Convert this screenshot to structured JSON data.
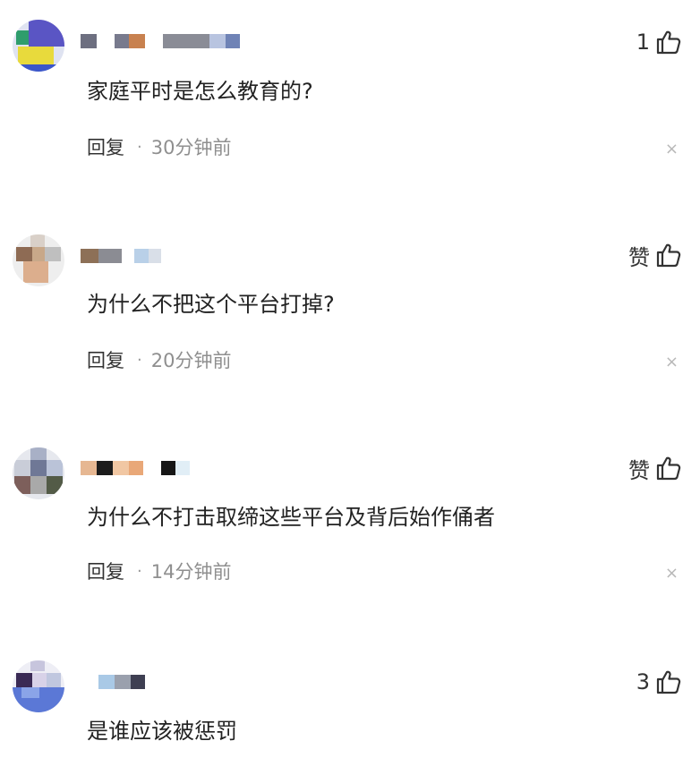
{
  "comments": [
    {
      "text": "家庭平时是怎么教育的?",
      "like_label": "1",
      "reply_label": "回复",
      "separator": "·",
      "time": "30分钟前",
      "close_glyph": "×"
    },
    {
      "text": "为什么不把这个平台打掉?",
      "like_label": "赞",
      "reply_label": "回复",
      "separator": "·",
      "time": "20分钟前",
      "close_glyph": "×"
    },
    {
      "text": "为什么不打击取缔这些平台及背后始作俑者",
      "like_label": "赞",
      "reply_label": "回复",
      "separator": "·",
      "time": "14分钟前",
      "close_glyph": "×"
    },
    {
      "text": "是谁应该被惩罚",
      "like_label": "3"
    }
  ],
  "icons": {
    "like": "thumbs-up-icon",
    "close": "close-icon"
  },
  "colors": {
    "text_primary": "#222222",
    "text_secondary": "#8f8f8f",
    "close": "#b8b8b8"
  }
}
